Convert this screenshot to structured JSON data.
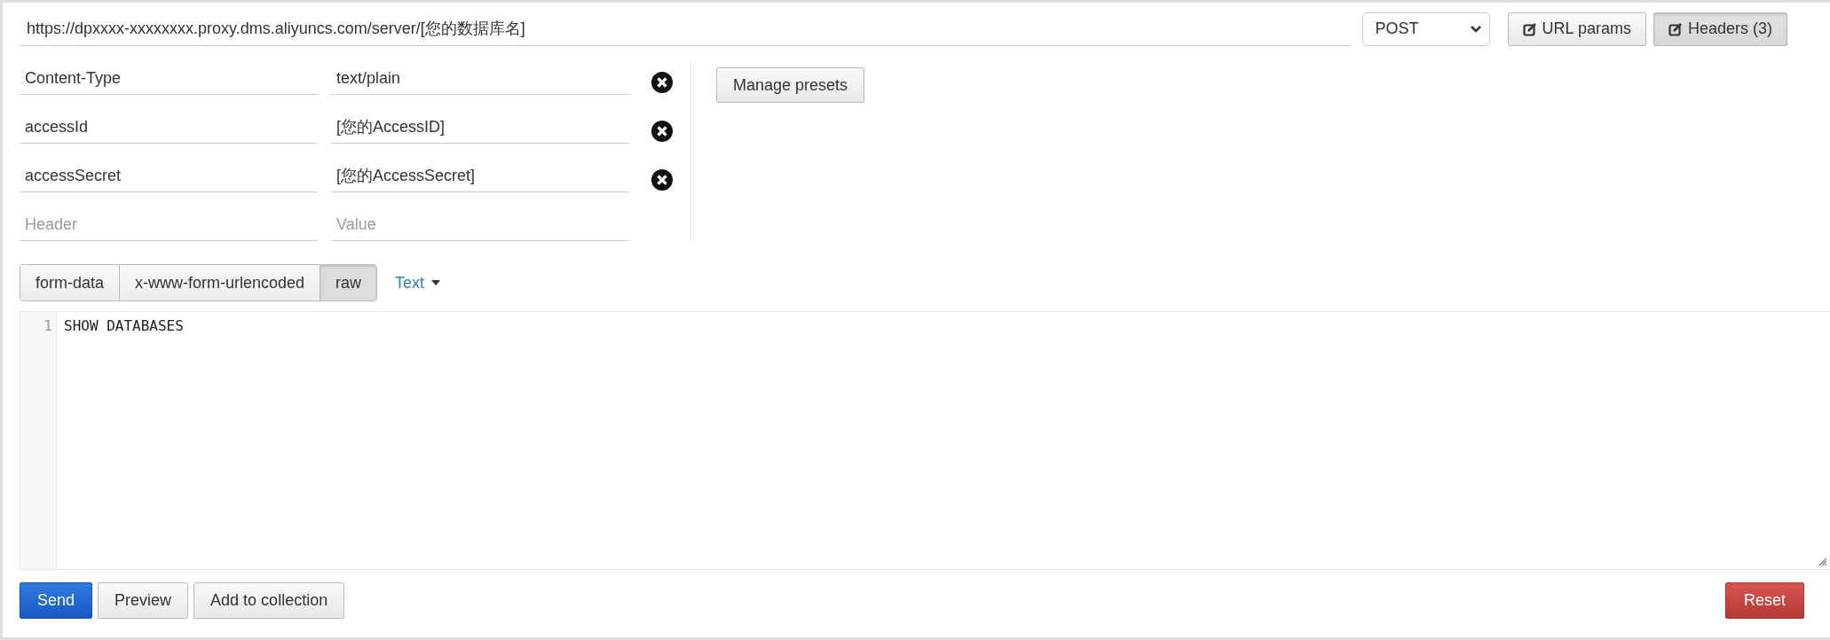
{
  "url": {
    "value": "https://dpxxxx-xxxxxxxx.proxy.dms.aliyuncs.com/server/[您的数据库名]"
  },
  "method": {
    "value": "POST"
  },
  "toggles": [
    {
      "label": "URL params",
      "selected": false
    },
    {
      "label": "Headers (3)",
      "selected": true
    }
  ],
  "headers": [
    {
      "key": "Content-Type",
      "value": "text/plain"
    },
    {
      "key": "accessId",
      "value": "[您的AccessID]"
    },
    {
      "key": "accessSecret",
      "value": "[您的AccessSecret]"
    }
  ],
  "new_header": {
    "key_placeholder": "Header",
    "value_placeholder": "Value"
  },
  "manage_presets": "Manage presets",
  "body_tabs": [
    {
      "label": "form-data",
      "selected": false
    },
    {
      "label": "x-www-form-urlencoded",
      "selected": false
    },
    {
      "label": "raw",
      "selected": true
    }
  ],
  "body_format": "Text",
  "editor": {
    "lines": [
      {
        "number": "1",
        "text": "SHOW DATABASES"
      }
    ]
  },
  "actions": [
    {
      "label": "Send",
      "kind": "primary"
    },
    {
      "label": "Preview",
      "kind": "default"
    },
    {
      "label": "Add to collection",
      "kind": "default"
    }
  ],
  "reset": "Reset"
}
